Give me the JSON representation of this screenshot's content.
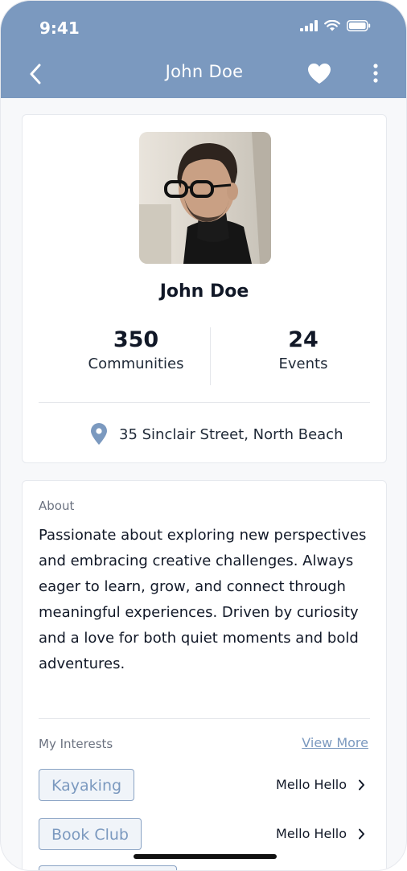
{
  "status_bar": {
    "time": "9:41"
  },
  "nav": {
    "title": "John Doe",
    "back_icon": "chevron-left-icon",
    "heart_icon": "heart-icon",
    "more_icon": "more-vertical-icon"
  },
  "profile": {
    "name": "John Doe",
    "stats": [
      {
        "value": "350",
        "label": "Communities"
      },
      {
        "value": "24",
        "label": "Events"
      }
    ],
    "address": "35 Sinclair Street, North Beach"
  },
  "about": {
    "label": "About",
    "text": "Passionate about exploring new perspectives and embracing creative challenges. Always eager to learn, grow, and connect through meaningful experiences. Driven by curiosity and a love for both quiet moments and bold adventures."
  },
  "interests": {
    "label": "My Interests",
    "view_more": "View More",
    "items": [
      {
        "chip": "Kayaking",
        "right_text": "Mello Hello"
      },
      {
        "chip": "Book Club",
        "right_text": "Mello Hello"
      }
    ]
  },
  "colors": {
    "header": "#7b99bf",
    "accent": "#7b99bf"
  }
}
